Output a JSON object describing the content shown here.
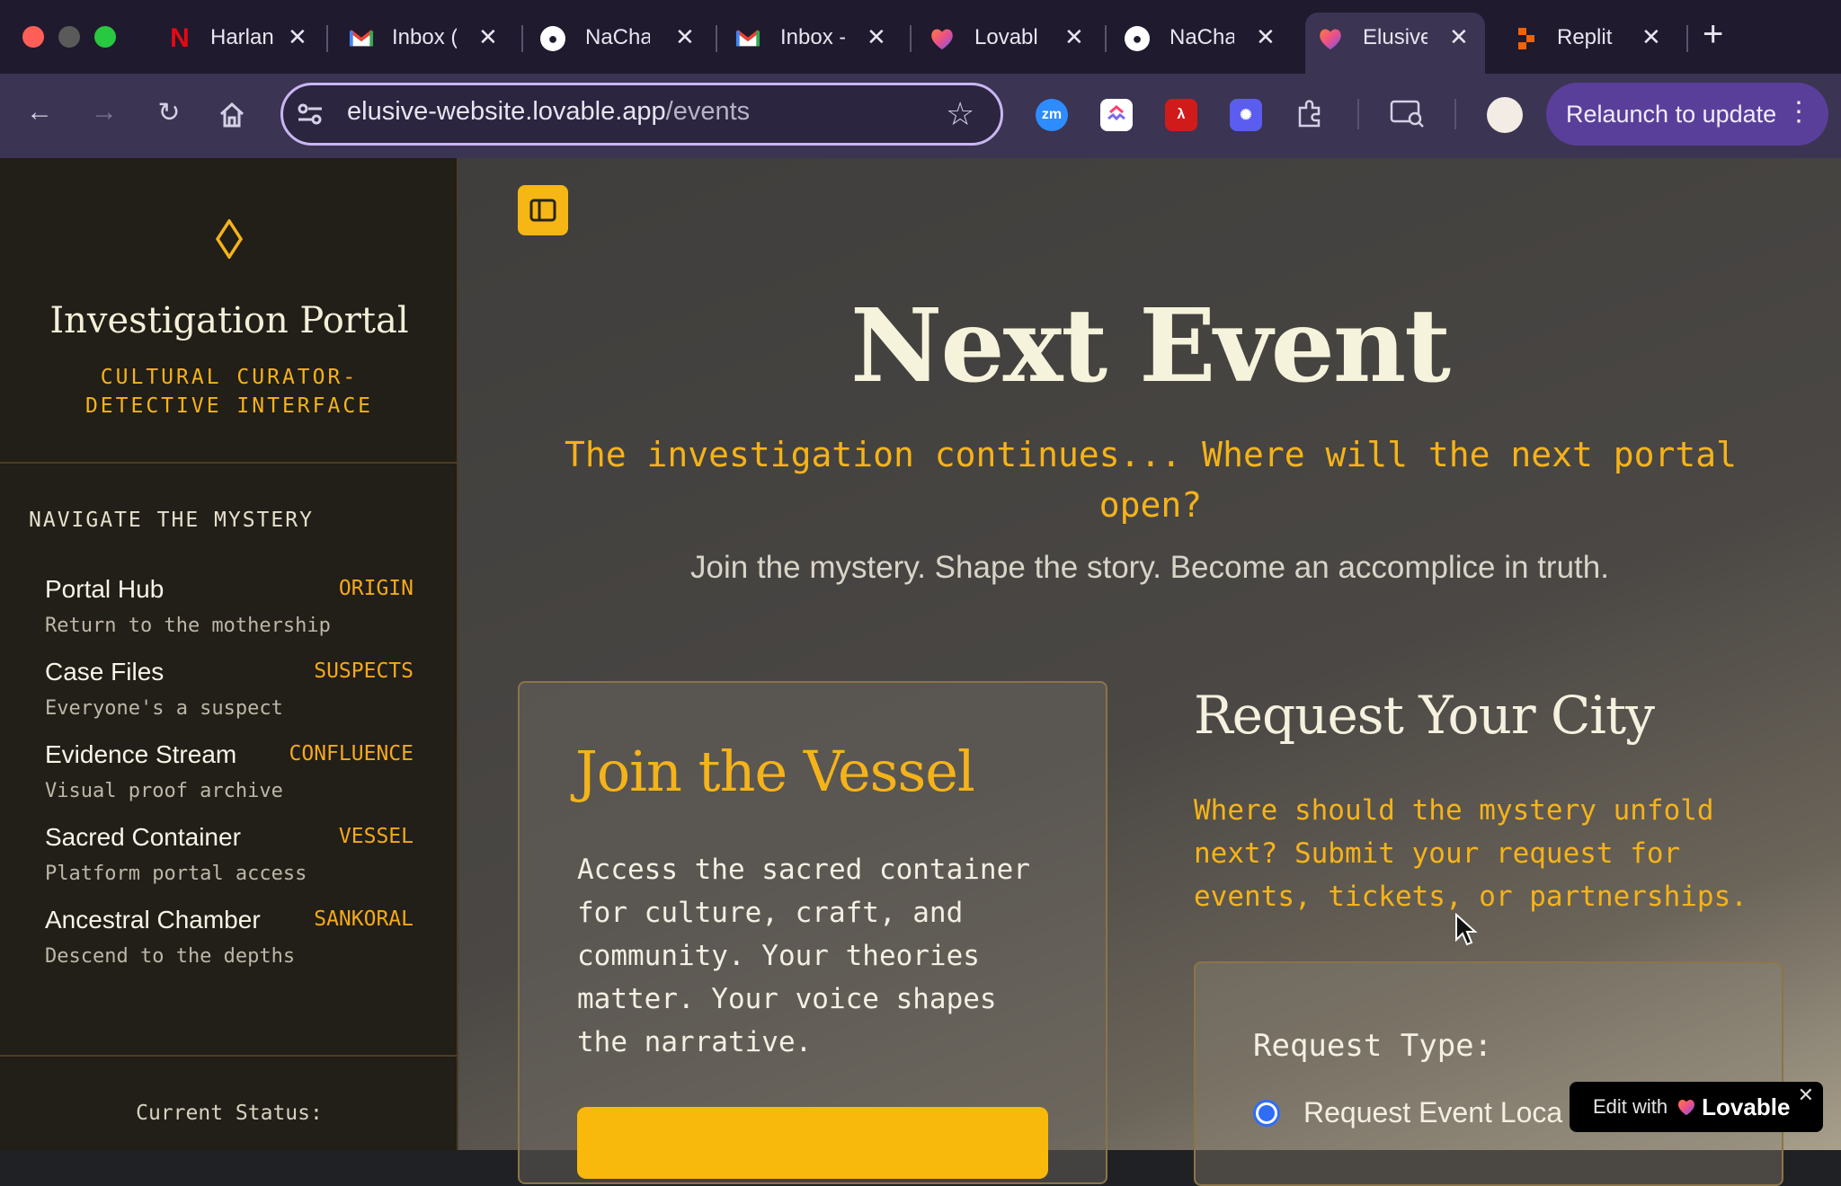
{
  "browser": {
    "tabs": [
      {
        "title": "Harlan",
        "icon": "netflix-icon"
      },
      {
        "title": "Inbox (",
        "icon": "gmail-icon"
      },
      {
        "title": "NaCha",
        "icon": "github-icon"
      },
      {
        "title": "Inbox -",
        "icon": "gmail-icon"
      },
      {
        "title": "Lovabl",
        "icon": "lovable-icon"
      },
      {
        "title": "NaCha",
        "icon": "github-icon"
      },
      {
        "title": "Elusive",
        "icon": "lovable-icon"
      },
      {
        "title": "Replit",
        "icon": "replit-icon"
      }
    ],
    "url_host": "elusive-website.lovable.app",
    "url_path": "/events",
    "zm_label": "zm",
    "relaunch_label": "Relaunch to update"
  },
  "sidebar": {
    "title": "Investigation Portal",
    "subtitle": "CULTURAL CURATOR-DETECTIVE INTERFACE",
    "nav_heading": "NAVIGATE THE MYSTERY",
    "items": [
      {
        "label": "Portal Hub",
        "tag": "ORIGIN",
        "desc": "Return to the mothership"
      },
      {
        "label": "Case Files",
        "tag": "SUSPECTS",
        "desc": "Everyone's a suspect"
      },
      {
        "label": "Evidence Stream",
        "tag": "CONFLUENCE",
        "desc": "Visual proof archive"
      },
      {
        "label": "Sacred Container",
        "tag": "VESSEL",
        "desc": "Platform portal access"
      },
      {
        "label": "Ancestral Chamber",
        "tag": "SANKORAL",
        "desc": "Descend to the depths"
      }
    ],
    "status_label": "Current Status:"
  },
  "main": {
    "title": "Next Event",
    "tagline": "The investigation continues... Where will the next portal open?",
    "subtitle": "Join the mystery. Shape the story. Become an accomplice in truth.",
    "join_card": {
      "title": "Join the Vessel",
      "body": "Access the sacred container for culture, craft, and community. Your theories matter. Your voice shapes the narrative."
    },
    "request": {
      "title": "Request Your City",
      "desc": "Where should the mystery unfold next? Submit your request for events, tickets, or partnerships.",
      "type_label": "Request Type:",
      "option_1": "Request Event Loca"
    }
  },
  "badge": {
    "edit_label": "Edit with",
    "brand": "Lovable"
  },
  "colors": {
    "accent": "#f5b31a",
    "sidebar_bg": "#221e18",
    "toolbar_bg": "#3b3452"
  }
}
